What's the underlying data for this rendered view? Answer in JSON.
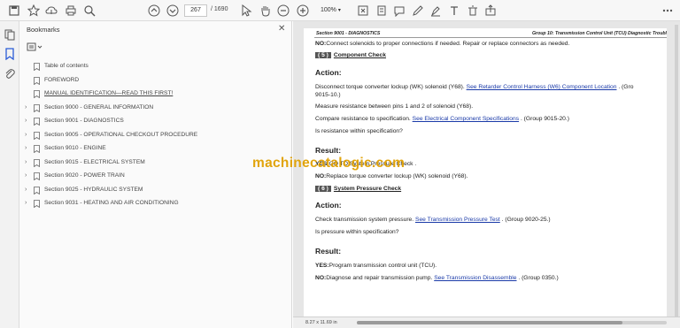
{
  "toolbar": {
    "page_current": "267",
    "page_total": "/ 1690",
    "zoom": "100%"
  },
  "bookmarks": {
    "title": "Bookmarks",
    "items": [
      {
        "label": "Table of contents",
        "expandable": false,
        "underline": false
      },
      {
        "label": "FOREWORD",
        "expandable": false,
        "underline": false
      },
      {
        "label": "MANUAL IDENTIFICATION—READ THIS FIRST!",
        "expandable": false,
        "underline": true
      },
      {
        "label": "Section 9000 - GENERAL INFORMATION",
        "expandable": true,
        "underline": false
      },
      {
        "label": "Section 9001 - DIAGNOSTICS",
        "expandable": true,
        "underline": false
      },
      {
        "label": "Section 9005 - OPERATIONAL CHECKOUT PROCEDURE",
        "expandable": true,
        "underline": false
      },
      {
        "label": "Section 9010 - ENGINE",
        "expandable": true,
        "underline": false
      },
      {
        "label": "Section 9015 - ELECTRICAL SYSTEM",
        "expandable": true,
        "underline": false
      },
      {
        "label": "Section 9020 - POWER TRAIN",
        "expandable": true,
        "underline": false
      },
      {
        "label": "Section 9025 - HYDRAULIC SYSTEM",
        "expandable": true,
        "underline": false
      },
      {
        "label": "Section 9031 - HEATING AND AIR CONDITIONING",
        "expandable": true,
        "underline": false
      }
    ]
  },
  "document": {
    "header_left": "Section 9001 - DIAGNOSTICS",
    "header_right": "Group 10: Transmission Control Unit (TCU) Diagnostic Troubl",
    "line_no_top_b": "NO:",
    "line_no_top": "Connect solenoids to proper connections if needed. Repair or replace connectors as needed.",
    "step5_num": "( 5 )",
    "step5_title": "Component Check",
    "action1_heading": "Action:",
    "action1_text1": "Disconnect torque converter lockup (WK) solenoid (Y68). ",
    "action1_link1": "See Retarder Control Harness (W6) Component Location",
    "action1_text1b": " . (Gro",
    "action1_text1c": "9015-10.)",
    "action1_text2": "Measure resistance between pins 1 and 2 of solenoid (Y68).",
    "action1_text3": "Compare resistance to specification. ",
    "action1_link3": "See Electrical Component Specifications",
    "action1_text3b": " . (Group 9015-20.)",
    "action1_text4": "Is resistance within specification?",
    "result1_heading": "Result:",
    "result1_yes_b": "YES:",
    "result1_yes": "GO TO System Pressure Check .",
    "result1_no_b": "NO:",
    "result1_no": "Replace torque converter lockup (WK) solenoid (Y68).",
    "step6_num": "( 6 )",
    "step6_title": "System Pressure Check",
    "action2_heading": "Action:",
    "action2_text1": "Check transmission system pressure. ",
    "action2_link1": "See Transmission Pressure Test",
    "action2_text1b": " . (Group 9020-25.)",
    "action2_text2": "Is pressure within specification?",
    "result2_heading": "Result:",
    "result2_yes_b": "YES:",
    "result2_yes": "Program transmission control unit (TCU).",
    "result2_no_b": "NO:",
    "result2_no": "Diagnose and repair transmission pump. ",
    "result2_no_link": "See Transmission Disassemble",
    "result2_no_b2": " . (Group 0350.)"
  },
  "watermark": "machinecatalogic.com",
  "status": {
    "page_size": "8.27 x 11.69 in"
  }
}
